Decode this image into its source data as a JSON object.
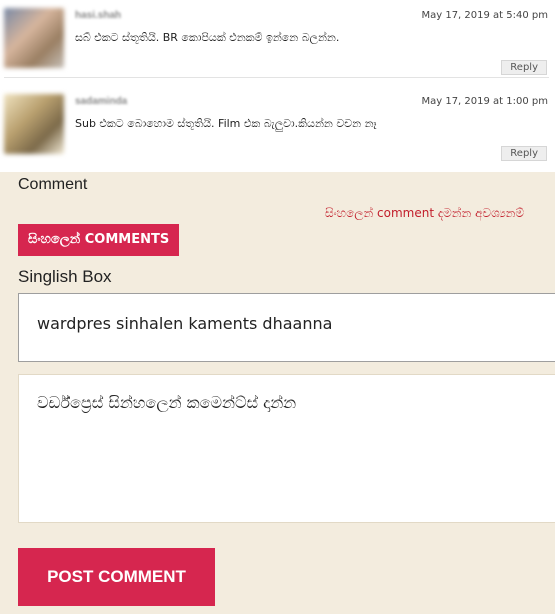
{
  "comments": [
    {
      "author": "hasi.shah",
      "date": "May 17, 2019 at 5:40 pm",
      "text": "සබ් එකට ස්තූතියි. BR කොපියක් එනකම් ඉන්නෙ බලන්න.",
      "reply_label": "Reply"
    },
    {
      "author": "sadaminda",
      "date": "May 17, 2019 at 1:00 pm",
      "text": "Sub එකට බොහොම ස්තූතියි. Film එක බැලුවා.කියන්න වචන නෑ",
      "reply_label": "Reply"
    }
  ],
  "form": {
    "comment_label": "Comment",
    "notice": "සිංහලෙන් comment දමන්න අවශ්‍යනම්",
    "sinhala_button": "සිංහලෙන් COMMENTS",
    "singlish_label": "Singlish Box",
    "singlish_value": "wardpres sinhalen kaments dhaanna",
    "comment_value": "වර්ඩ්ප්‍රෙස් සින්හලෙන් කමෙන්ට්ස් දාන්න",
    "post_button": "POST COMMENT"
  },
  "colors": {
    "accent": "#d6264f",
    "notice_red": "#c21d2a",
    "page_bg": "#f3ecde"
  }
}
